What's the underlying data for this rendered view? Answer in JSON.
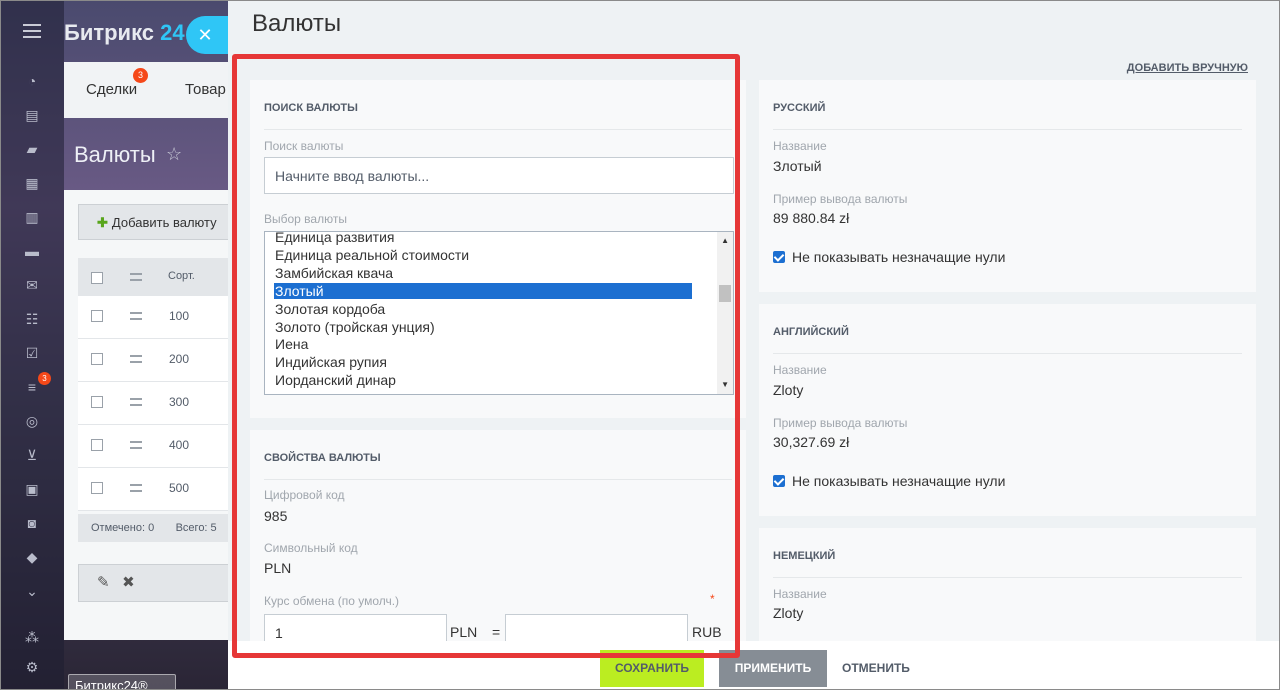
{
  "bg": {
    "logo_main": "Битрикс",
    "logo_num": "24",
    "tab_deals": "Сделки",
    "tab_deals_badge": "3",
    "tab_goods": "Товар",
    "title": "Валюты",
    "add_label": "Добавить валюту",
    "sort_header": "Сорт.",
    "rows": [
      "100",
      "200",
      "300",
      "400",
      "500"
    ],
    "footer_marked": "Отмечено: 0",
    "footer_total": "Всего: 5",
    "sidebar_badge": "3",
    "bottom_label": "Битрикс24®"
  },
  "slider": {
    "title": "Валюты",
    "add_manual": "ДОБАВИТЬ ВРУЧНУЮ",
    "search_section": {
      "title": "ПОИСК ВАЛЮТЫ",
      "search_label": "Поиск валюты",
      "search_placeholder": "Начните ввод валюты...",
      "select_label": "Выбор валюты",
      "options": [
        "Единица развития",
        "Единица реальной стоимости",
        "Замбийская квача",
        "Злотый",
        "Золотая кордоба",
        "Золото (тройская унция)",
        "Иена",
        "Индийская рупия",
        "Иорданский динар"
      ],
      "selected": "Злотый"
    },
    "props_section": {
      "title": "СВОЙСТВА ВАЛЮТЫ",
      "num_code_label": "Цифровой код",
      "num_code": "985",
      "sym_code_label": "Символьный код",
      "sym_code": "PLN",
      "rate_label": "Курс обмена (по умолч.)",
      "required_mark": "*",
      "rate_value": "1",
      "rate_unit": "PLN",
      "equals": "=",
      "rate_target_value": "",
      "rate_target_unit": "RUB"
    },
    "lang_sections": [
      {
        "title": "РУССКИЙ",
        "name_label": "Название",
        "name": "Злотый",
        "example_label": "Пример вывода валюты",
        "example": "89 880.84 zł",
        "checkbox_label": "Не показывать незначащие нули"
      },
      {
        "title": "АНГЛИЙСКИЙ",
        "name_label": "Название",
        "name": "Zloty",
        "example_label": "Пример вывода валюты",
        "example": "30,327.69 zł",
        "checkbox_label": "Не показывать незначащие нули"
      },
      {
        "title": "НЕМЕЦКИЙ",
        "name_label": "Название",
        "name": "Zloty"
      }
    ],
    "footer": {
      "save": "СОХРАНИТЬ",
      "apply": "ПРИМЕНИТЬ",
      "cancel": "ОТМЕНИТЬ"
    }
  },
  "colors": {
    "accent_blue": "#2fc6f6",
    "save_green": "#bbed21",
    "highlight_red": "#e63737",
    "selection_blue": "#1c6fd1"
  }
}
